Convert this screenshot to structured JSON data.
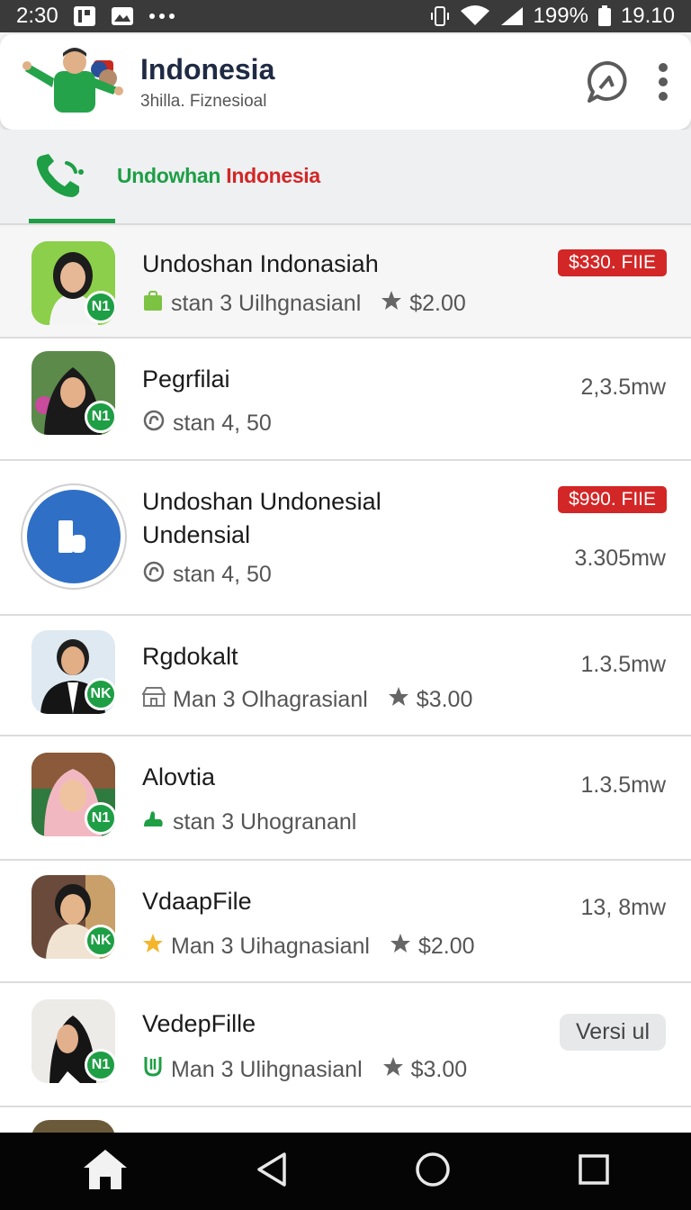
{
  "status_bar": {
    "time": "2:30",
    "battery_percent": "199%",
    "clock_right": "19.10"
  },
  "header": {
    "title": "Indonesia",
    "subtitle": "3hilla. Fiznesioal",
    "icons": [
      "chat-icon",
      "more-vert-icon"
    ]
  },
  "tab": {
    "label_green": "Undowhan",
    "label_red": "Indonesia",
    "icon": "phone-icon",
    "accent": "#1e9e45",
    "red": "#d32626"
  },
  "list": [
    {
      "title": "Undoshan Indonasiah",
      "title_line2": "",
      "meta_icon": "green-bag-icon",
      "meta": "stan 3 Uilhgnasianl",
      "rating": "$2.00",
      "right": "$330. FIIE",
      "right_type": "price",
      "badge": "N1"
    },
    {
      "title": "Pegrfilai",
      "title_line2": "",
      "meta_icon": "hanger-icon",
      "meta": "stan 4, 50",
      "rating": "",
      "right": "2,3.5mw",
      "right_type": "text",
      "badge": "N1"
    },
    {
      "title": "Undoshan Undonesial",
      "title_line2": "Undensial",
      "meta_icon": "hanger-icon",
      "meta": "stan 4, 50",
      "rating": "",
      "right": "$990. FIIE",
      "right2": "3.305mw",
      "right_type": "price",
      "badge": ""
    },
    {
      "title": "Rgdokalt",
      "title_line2": "",
      "meta_icon": "store-icon",
      "meta": "Man 3 Olhagrasianl",
      "rating": "$3.00",
      "right": "1.3.5mw",
      "right_type": "text",
      "badge": "NK"
    },
    {
      "title": "Alovtia",
      "title_line2": "",
      "meta_icon": "green-hand-icon",
      "meta": "stan 3 Uhogrananl",
      "rating": "",
      "right": "1.3.5mw",
      "right_type": "text",
      "badge": "N1"
    },
    {
      "title": "VdaapFile",
      "title_line2": "",
      "meta_icon": "yellow-star-icon",
      "meta": "Man 3 Uihagnasianl",
      "rating": "$2.00",
      "right": "13, 8mw",
      "right_type": "text",
      "badge": "NK"
    },
    {
      "title": "VedepFille",
      "title_line2": "",
      "meta_icon": "green-u-icon",
      "meta": "Man 3 Ulihgnasianl",
      "rating": "$3.00",
      "right": "Versi ul",
      "right_type": "version",
      "badge": "N1"
    }
  ]
}
